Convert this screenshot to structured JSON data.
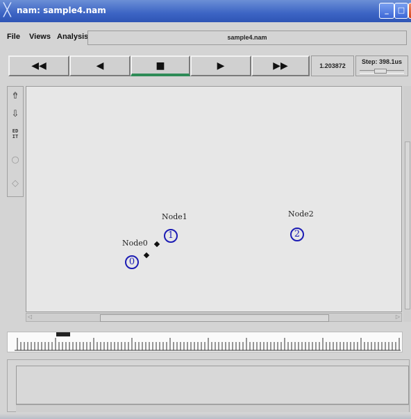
{
  "window": {
    "title": "nam: sample4.nam",
    "buttons": {
      "minimize": "_",
      "maximize": "□",
      "close": "✕"
    }
  },
  "menu": {
    "file": "File",
    "views": "Views",
    "analysis": "Analysis"
  },
  "file_name": "sample4.nam",
  "controls": {
    "rewind": "◀◀",
    "back": "◀",
    "stop": "■",
    "play": "▶",
    "fast_forward": "▶▶"
  },
  "time_display": "1.203872",
  "step": {
    "label": "Step: 398.1us"
  },
  "nodes": [
    {
      "id": "0",
      "label": "Node0"
    },
    {
      "id": "1",
      "label": "Node1"
    },
    {
      "id": "2",
      "label": "Node2"
    }
  ],
  "colors": {
    "node": "#1c1cb4",
    "active_control": "#2e8b57",
    "titlebar": "#3c64c4"
  },
  "icons": [
    "zoom-in-icon",
    "zoom-out-icon",
    "edit-icon",
    "circle-tool-icon",
    "diamond-tool-icon"
  ]
}
